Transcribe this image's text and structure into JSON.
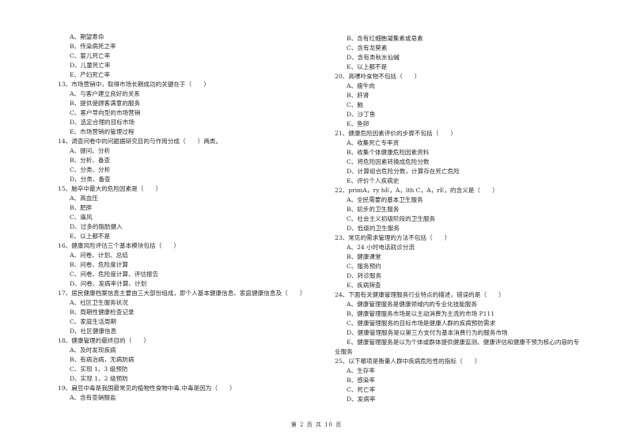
{
  "left_column": [
    {
      "type": "opt",
      "text": "A、期望寿命"
    },
    {
      "type": "opt",
      "text": "B、传染病死之率"
    },
    {
      "type": "opt",
      "text": "C、婴儿死亡率"
    },
    {
      "type": "opt",
      "text": "D、儿童死亡率"
    },
    {
      "type": "opt",
      "text": "E、产妇死亡率"
    },
    {
      "type": "q",
      "text": "13、市场营销中，取得市场长期成功的关键在于（　　）"
    },
    {
      "type": "opt",
      "text": "A、与客户建立良好的关系"
    },
    {
      "type": "opt",
      "text": "B、提供使顾客满意的服务"
    },
    {
      "type": "opt",
      "text": "C、客户导向型的市场营销"
    },
    {
      "type": "opt",
      "text": "D、选定合理的目标市场"
    },
    {
      "type": "opt",
      "text": "E、市场营销的管理过程"
    },
    {
      "type": "q",
      "text": "14、调查问卷中的问题据研究目的与作用分成（　　）两类。"
    },
    {
      "type": "opt",
      "text": "A、提问、分析"
    },
    {
      "type": "opt",
      "text": "B、分析、备查"
    },
    {
      "type": "opt",
      "text": "C、分类、分析"
    },
    {
      "type": "opt",
      "text": "D、分类、备查"
    },
    {
      "type": "q",
      "text": "15、脑卒中最大的危险因素是（　　）"
    },
    {
      "type": "opt",
      "text": "A、高血压"
    },
    {
      "type": "opt",
      "text": "B、肥胖"
    },
    {
      "type": "opt",
      "text": "C、痛风"
    },
    {
      "type": "opt",
      "text": "D、过多的脂肪摄入"
    },
    {
      "type": "opt",
      "text": "E、以上都不是"
    },
    {
      "type": "q",
      "text": "16、健康风险评估三个基本模块包括（　　）"
    },
    {
      "type": "opt",
      "text": "A、问卷、计划、总结"
    },
    {
      "type": "opt",
      "text": "B、问卷、危险度计算"
    },
    {
      "type": "opt",
      "text": "C、问卷、危险度计算、评估报告"
    },
    {
      "type": "opt",
      "text": "D、问卷、发病率计算、计划"
    },
    {
      "type": "q",
      "text": "17、居民健康档案信息主要由三大部份组成，即个人基本健康信息、家庭健康信息及（　　）"
    },
    {
      "type": "opt",
      "text": "A、社区卫生服务状况"
    },
    {
      "type": "opt",
      "text": "B、周期性健康检查记录"
    },
    {
      "type": "opt",
      "text": "C、家庭生活周期"
    },
    {
      "type": "opt",
      "text": "D、社区健康信息"
    },
    {
      "type": "q",
      "text": "18、健康管理的最终目的（　　）"
    },
    {
      "type": "opt",
      "text": "A、及时发现疾病"
    },
    {
      "type": "opt",
      "text": "B、有病治病，无病防病"
    },
    {
      "type": "opt",
      "text": "C、实现 1、3 级预防"
    },
    {
      "type": "opt",
      "text": "D、实现 1、2 级预防"
    },
    {
      "type": "q",
      "text": "19、扁豆中毒是我国最常见的植物性食物中毒,中毒是因为（　　）"
    },
    {
      "type": "opt",
      "text": "A、含有亚硝酸盐"
    }
  ],
  "right_column": [
    {
      "type": "opt",
      "text": "B、含有红细胞凝集素或皂素"
    },
    {
      "type": "opt",
      "text": "C、含有龙葵素"
    },
    {
      "type": "opt",
      "text": "D、含有类秋水仙碱"
    },
    {
      "type": "opt",
      "text": "E、以上都不是"
    },
    {
      "type": "q",
      "text": "20、高嘌呤食物不包括（　　）"
    },
    {
      "type": "opt",
      "text": "A、瘦牛肉"
    },
    {
      "type": "opt",
      "text": "B、肝肾"
    },
    {
      "type": "opt",
      "text": "C、脑"
    },
    {
      "type": "opt",
      "text": "D、沙丁鱼"
    },
    {
      "type": "opt",
      "text": "E、鱼卵"
    },
    {
      "type": "q",
      "text": "21、健康危险因素评价的步骤不包括（　　）"
    },
    {
      "type": "opt",
      "text": "A、收集死亡专率资"
    },
    {
      "type": "opt",
      "text": "B、收集个体健康危险因素资料"
    },
    {
      "type": "opt",
      "text": "C、将危险因素转换成危险分数"
    },
    {
      "type": "opt",
      "text": "D、计算组合危险分数，计算存在死亡危险"
    },
    {
      "type": "opt",
      "text": "E、评价个人疾病史"
    },
    {
      "type": "q",
      "text": "22、primA，ry hE，A，lth C，A，rE，的含义是（　　）"
    },
    {
      "type": "opt",
      "text": "A、全民需要的基本卫生服务"
    },
    {
      "type": "opt",
      "text": "B、初步的卫生服务"
    },
    {
      "type": "opt",
      "text": "C、社会主义初级阶段的卫生服务"
    },
    {
      "type": "opt",
      "text": "D、低级的卫生服务"
    },
    {
      "type": "q",
      "text": "23、常见的需求管理的方法不包括（　　）"
    },
    {
      "type": "opt",
      "text": "A、24 小时电话就诊分流"
    },
    {
      "type": "opt",
      "text": "B、健康课堂"
    },
    {
      "type": "opt",
      "text": "C、服务预约"
    },
    {
      "type": "opt",
      "text": "D、转诊服务"
    },
    {
      "type": "opt",
      "text": "E、疾病筛查"
    },
    {
      "type": "q",
      "text": "24、下面有关健康管理服务行业特点的描述，错误的是（　　）"
    },
    {
      "type": "opt",
      "text": "A、健康管理服务是健康领域内的专业化技能服务"
    },
    {
      "type": "opt",
      "text": "B、健康管理服务市场是以主动消费为主流的市场 P111"
    },
    {
      "type": "opt",
      "text": "C、健康管理服务的目标市场是健康人群的疾病预防需求"
    },
    {
      "type": "opt",
      "text": "D、健康管理服务是以第三方支付为基本消费行为的服务市场"
    },
    {
      "type": "opt",
      "text": "E、健康管理服务是以为个体或群体提供健康监测、健康评估和健康干预为核心内容的专"
    },
    {
      "type": "cont",
      "text": "业服务"
    },
    {
      "type": "q",
      "text": "25、以下哪项是衡量人群中疾病危险性的指标（　　）"
    },
    {
      "type": "opt",
      "text": "A、生存率"
    },
    {
      "type": "opt",
      "text": "B、感染率"
    },
    {
      "type": "opt",
      "text": "C、死亡率"
    },
    {
      "type": "opt",
      "text": "D、发病率"
    }
  ],
  "footer": {
    "page_label": "第 2 页 共 10 页"
  }
}
